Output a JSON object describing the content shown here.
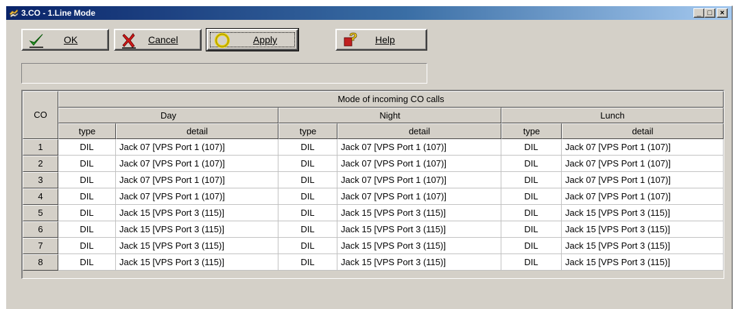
{
  "window": {
    "title": "3.CO - 1.Line Mode",
    "app_icon": "hands-icon",
    "minimize": "_",
    "maximize": "□",
    "close": "×"
  },
  "toolbar": {
    "ok_label": "OK",
    "cancel_label": "Cancel",
    "apply_label": "Apply",
    "help_label": "Help",
    "ok_icon": "checkmark-icon",
    "cancel_icon": "x-mark-icon",
    "apply_icon": "yellow-ring-icon",
    "help_icon": "question-mark-icon"
  },
  "status": {
    "message": ""
  },
  "grid": {
    "co_header": "CO",
    "group_header": "Mode of incoming CO calls",
    "modes": [
      "Day",
      "Night",
      "Lunch"
    ],
    "type_header": "type",
    "detail_header": "detail",
    "rows": [
      {
        "co": "1",
        "day": {
          "type": "DIL",
          "detail": "Jack 07 [VPS Port 1 (107)]"
        },
        "night": {
          "type": "DIL",
          "detail": "Jack 07 [VPS Port 1 (107)]"
        },
        "lunch": {
          "type": "DIL",
          "detail": "Jack 07 [VPS Port 1 (107)]"
        }
      },
      {
        "co": "2",
        "day": {
          "type": "DIL",
          "detail": "Jack 07 [VPS Port 1 (107)]"
        },
        "night": {
          "type": "DIL",
          "detail": "Jack 07 [VPS Port 1 (107)]"
        },
        "lunch": {
          "type": "DIL",
          "detail": "Jack 07 [VPS Port 1 (107)]"
        }
      },
      {
        "co": "3",
        "day": {
          "type": "DIL",
          "detail": "Jack 07 [VPS Port 1 (107)]"
        },
        "night": {
          "type": "DIL",
          "detail": "Jack 07 [VPS Port 1 (107)]"
        },
        "lunch": {
          "type": "DIL",
          "detail": "Jack 07 [VPS Port 1 (107)]"
        }
      },
      {
        "co": "4",
        "day": {
          "type": "DIL",
          "detail": "Jack 07 [VPS Port 1 (107)]"
        },
        "night": {
          "type": "DIL",
          "detail": "Jack 07 [VPS Port 1 (107)]"
        },
        "lunch": {
          "type": "DIL",
          "detail": "Jack 07 [VPS Port 1 (107)]"
        }
      },
      {
        "co": "5",
        "day": {
          "type": "DIL",
          "detail": "Jack 15 [VPS Port 3 (115)]"
        },
        "night": {
          "type": "DIL",
          "detail": "Jack 15 [VPS Port 3 (115)]"
        },
        "lunch": {
          "type": "DIL",
          "detail": "Jack 15 [VPS Port 3 (115)]"
        }
      },
      {
        "co": "6",
        "day": {
          "type": "DIL",
          "detail": "Jack 15 [VPS Port 3 (115)]"
        },
        "night": {
          "type": "DIL",
          "detail": "Jack 15 [VPS Port 3 (115)]"
        },
        "lunch": {
          "type": "DIL",
          "detail": "Jack 15 [VPS Port 3 (115)]"
        }
      },
      {
        "co": "7",
        "day": {
          "type": "DIL",
          "detail": "Jack 15 [VPS Port 3 (115)]"
        },
        "night": {
          "type": "DIL",
          "detail": "Jack 15 [VPS Port 3 (115)]"
        },
        "lunch": {
          "type": "DIL",
          "detail": "Jack 15 [VPS Port 3 (115)]"
        }
      },
      {
        "co": "8",
        "day": {
          "type": "DIL",
          "detail": "Jack 15 [VPS Port 3 (115)]"
        },
        "night": {
          "type": "DIL",
          "detail": "Jack 15 [VPS Port 3 (115)]"
        },
        "lunch": {
          "type": "DIL",
          "detail": "Jack 15 [VPS Port 3 (115)]"
        }
      }
    ]
  }
}
